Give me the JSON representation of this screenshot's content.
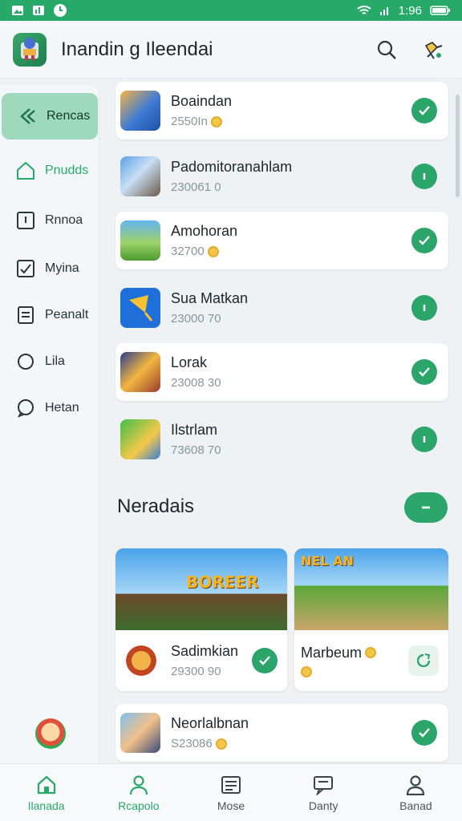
{
  "status_bar": {
    "time": "1:96"
  },
  "header": {
    "title": "Inandin g Ileendai",
    "search_icon": "search-icon",
    "settings_icon": "puzzle-icon"
  },
  "sidebar": {
    "items": [
      {
        "label": "Rencas",
        "icon": "back-arrow-icon"
      },
      {
        "label": "Pnudds",
        "icon": "home-icon"
      },
      {
        "label": "Rnnoa",
        "icon": "info-icon"
      },
      {
        "label": "Myina",
        "icon": "checkbox-icon"
      },
      {
        "label": "Peanalt",
        "icon": "document-icon"
      },
      {
        "label": "Lila",
        "icon": "circle-icon"
      },
      {
        "label": "Hetan",
        "icon": "chat-icon"
      }
    ]
  },
  "list": [
    {
      "name": "Boaindan",
      "sub": "2550In",
      "coin": true,
      "status": "check"
    },
    {
      "name": "Padomitoranahlam",
      "sub": "230061 0",
      "coin": false,
      "status": "dot"
    },
    {
      "name": "Amohoran",
      "sub": "32700",
      "coin": true,
      "status": "check"
    },
    {
      "name": "Sua Matkan",
      "sub": "23000 70",
      "coin": false,
      "status": "dot"
    },
    {
      "name": "Lorak",
      "sub": "23008 30",
      "coin": false,
      "status": "check"
    },
    {
      "name": "Ilstrlam",
      "sub": "73608 70",
      "coin": false,
      "status": "dot"
    }
  ],
  "section": {
    "title": "Neradais"
  },
  "featured": [
    {
      "banner_text": "BOREER",
      "name": "Sadimkian",
      "sub": "29300 90"
    },
    {
      "banner_text": "NEL AN",
      "name": "Marbeum",
      "sub": ""
    }
  ],
  "last_item": {
    "name": "Neorlalbnan",
    "sub": "S23086"
  },
  "bottom_nav": [
    {
      "label": "Ilanada",
      "icon": "home-icon"
    },
    {
      "label": "Rcapolo",
      "icon": "person-icon"
    },
    {
      "label": "Mose",
      "icon": "list-icon"
    },
    {
      "label": "Danty",
      "icon": "message-icon"
    },
    {
      "label": "Banad",
      "icon": "profile-icon"
    }
  ],
  "colors": {
    "accent": "#27a96a",
    "active_side": "#9fd9bd"
  }
}
